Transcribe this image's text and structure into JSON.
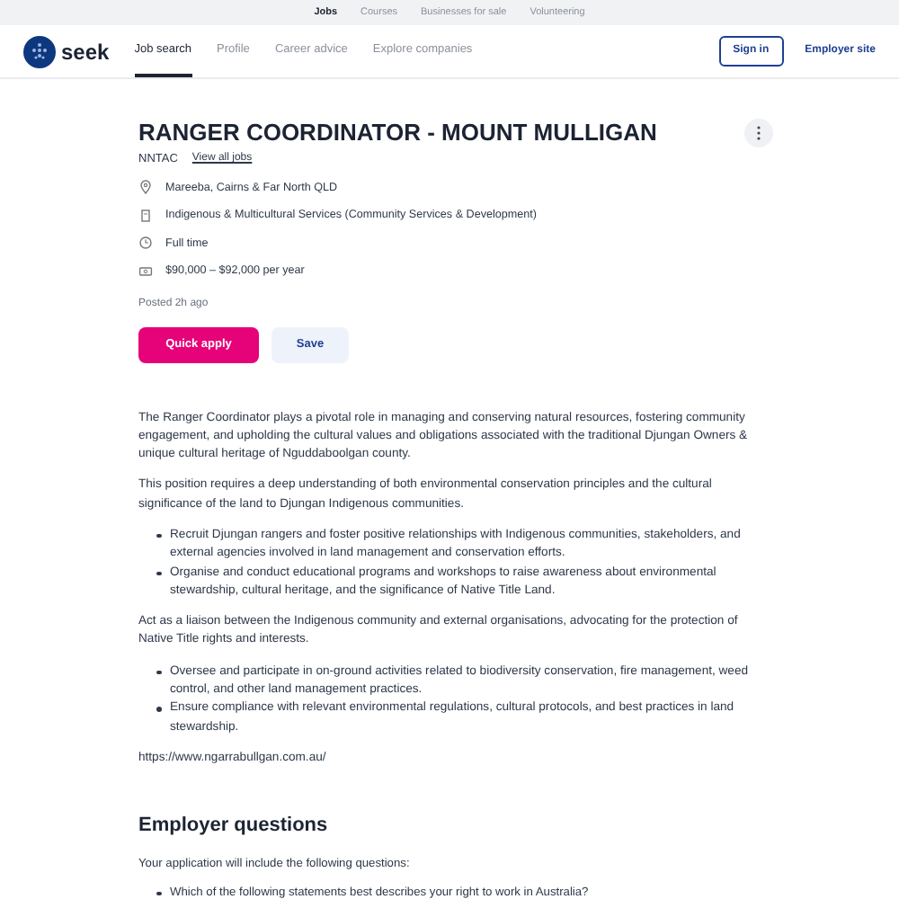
{
  "top_nav": [
    {
      "label": "Jobs",
      "selected": true
    },
    {
      "label": "Courses",
      "selected": false
    },
    {
      "label": "Businesses for sale",
      "selected": false
    },
    {
      "label": "Volunteering",
      "selected": false
    }
  ],
  "logo": {
    "text": "seek"
  },
  "main_nav": [
    {
      "label": "Job search",
      "selected": true
    },
    {
      "label": "Profile",
      "selected": false
    },
    {
      "label": "Career advice",
      "selected": false
    },
    {
      "label": "Explore companies",
      "selected": false
    }
  ],
  "sign_in": "Sign in",
  "employer_site": "Employer site",
  "job": {
    "title": "RANGER COORDINATOR - MOUNT MULLIGAN",
    "company": "NNTAC",
    "view_all": "View all jobs",
    "details": [
      {
        "kind": "location",
        "text": "Mareeba, Cairns & Far North QLD"
      },
      {
        "kind": "category",
        "text": "Indigenous & Multicultural Services (Community Services & Development)"
      },
      {
        "kind": "worktype",
        "text": "Full time"
      },
      {
        "kind": "salary",
        "text": "$90,000 – $92,000 per year"
      }
    ],
    "posted": "Posted 2h ago",
    "apply": "Quick apply",
    "save": "Save"
  },
  "description": [
    {
      "kind": "para",
      "text": "The Ranger Coordinator plays a pivotal role in managing and conserving natural resources, fostering community engagement, and upholding the cultural values and obligations associated with the traditional Djungan Owners & unique cultural heritage of Nguddaboolgan county."
    },
    {
      "kind": "para",
      "text": "This position requires a deep understanding of both environmental conservation principles and the cultural significance of the land to Djungan Indigenous communities."
    },
    {
      "kind": "list",
      "items": [
        "Recruit Djungan rangers and foster positive relationships with Indigenous communities, stakeholders, and external agencies involved in land management and conservation efforts.",
        "Organise and conduct educational programs and workshops to raise awareness about environmental stewardship, cultural heritage, and the significance of Native Title Land."
      ]
    },
    {
      "kind": "para",
      "text": "Act as a liaison between the Indigenous community and external organisations, advocating for the protection of Native Title rights and interests."
    },
    {
      "kind": "list",
      "items": [
        "Oversee and participate in on-ground activities related to biodiversity conservation, fire management, weed control, and other land management practices.",
        "Ensure compliance with relevant environmental regulations, cultural protocols, and best practices in land stewardship."
      ]
    },
    {
      "kind": "para",
      "text": "https://www.ngarrabullgan.com.au/"
    }
  ],
  "employer_questions": {
    "heading": "Employer questions",
    "intro": "Your application will include the following questions:",
    "questions": [
      "Which of the following statements best describes your right to work in Australia?"
    ]
  }
}
